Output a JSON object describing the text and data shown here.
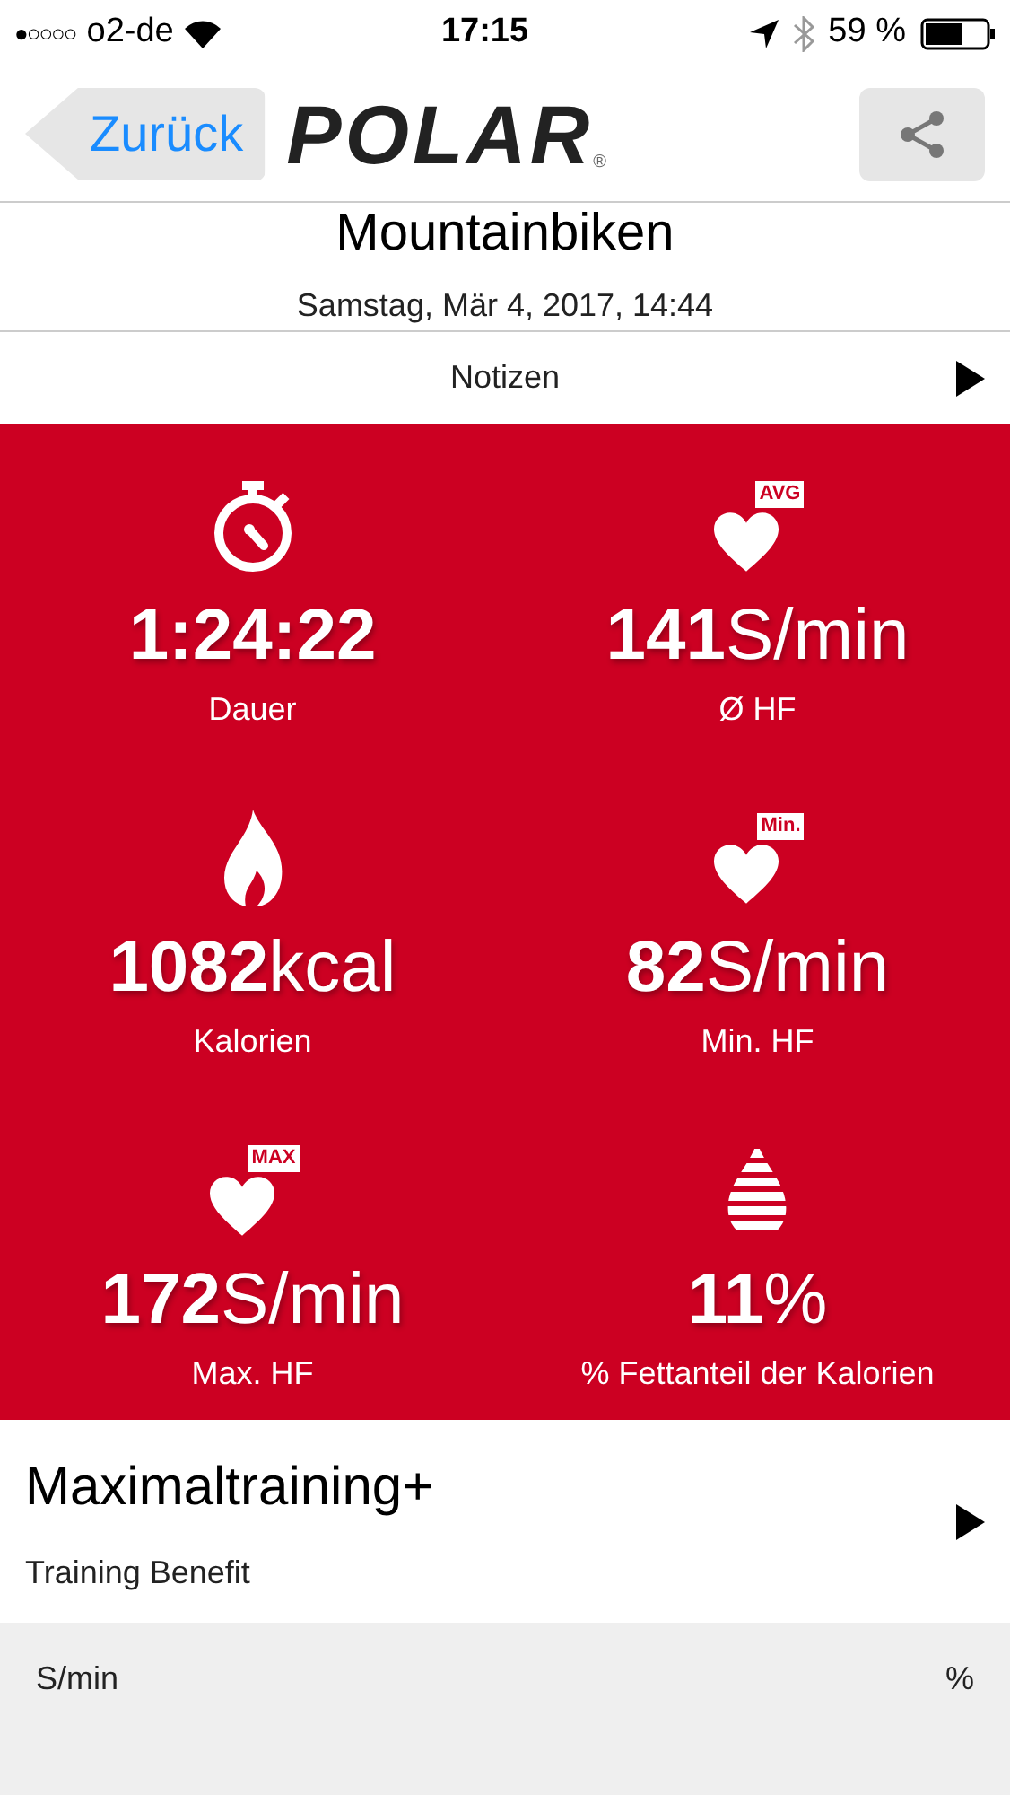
{
  "status_bar": {
    "signal_dots": "●○○○○",
    "carrier": "o2-de",
    "time": "17:15",
    "battery": "59 %"
  },
  "nav": {
    "back": "Zurück",
    "logo": "POLAR",
    "logo_mark": "®"
  },
  "header": {
    "title": "Mountainbiken",
    "date": "Samstag, Mär 4, 2017, 14:44"
  },
  "notes_row": {
    "label": "Notizen"
  },
  "metrics": [
    {
      "kind": "duration",
      "value": "1:24:22",
      "label": "Dauer"
    },
    {
      "kind": "heart",
      "badge": "AVG",
      "value": "141",
      "unit": "S/min",
      "label": "Ø HF"
    },
    {
      "kind": "calories",
      "value": "1082",
      "unit": "kcal",
      "label": "Kalorien"
    },
    {
      "kind": "heart",
      "badge": "Min.",
      "value": "82",
      "unit": "S/min",
      "label": "Min. HF"
    },
    {
      "kind": "heart",
      "badge": "MAX",
      "value": "172",
      "unit": "S/min",
      "label": "Max. HF"
    },
    {
      "kind": "fat",
      "value": "11",
      "unit": "%",
      "label": "% Fettanteil der Kalorien"
    }
  ],
  "benefit": {
    "title": "Maximaltraining+",
    "subtitle": "Training Benefit"
  },
  "chart_header": {
    "left": "S/min",
    "right": "%"
  }
}
